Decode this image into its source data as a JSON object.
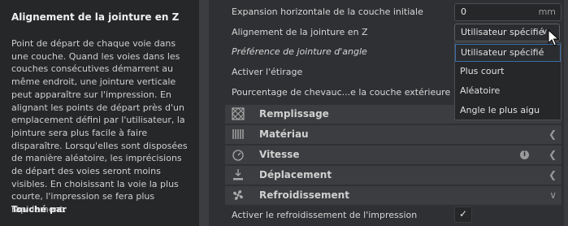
{
  "tooltip": {
    "title": "Alignement de la jointure en Z",
    "description": "Point de départ de chaque voie dans une couche. Quand les voies dans les couches consécutives démarrent au même endroit, une jointure verticale peut apparaître sur l'impression. En alignant les points de départ près d'un emplacement défini par l'utilisateur, la jointure sera plus facile à faire disparaître. Lorsqu'elles sont disposées de manière aléatoire, les imprécisions de départ des voies seront moins visibles. En choisissant la voie la plus courte, l'impression se fera plus rapidement.",
    "footer": "Touché par"
  },
  "settings": {
    "expansion": {
      "label": "Expansion horizontale de la couche initiale",
      "value": "0",
      "unit": "mm"
    },
    "seam_align": {
      "label": "Alignement de la jointure en Z",
      "value": "Utilisateur spécifié"
    },
    "corner_pref": {
      "label": "Préférence de jointure d'angle"
    },
    "ironing": {
      "label": "Activer l'étirage"
    },
    "overlap": {
      "label": "Pourcentage de chevauc...e la couche extérieure"
    },
    "cooling_enable": {
      "label": "Activer le refroidissement de l'impression",
      "checked": "✓"
    }
  },
  "dropdown": {
    "options": [
      "Utilisateur spécifié",
      "Plus court",
      "Aléatoire",
      "Angle le plus aigu"
    ],
    "selected_index": 0
  },
  "categories": [
    {
      "label": "Remplissage",
      "icon": "infill-icon"
    },
    {
      "label": "Matériau",
      "icon": "material-icon"
    },
    {
      "label": "Vitesse",
      "icon": "speed-icon",
      "info": "i"
    },
    {
      "label": "Déplacement",
      "icon": "travel-icon"
    },
    {
      "label": "Refroidissement",
      "icon": "fan-icon"
    }
  ],
  "colors": {
    "background": "#2f3033",
    "panel": "#262729",
    "category_bar": "#3c3d40",
    "selection_border": "#3b6ea8"
  }
}
